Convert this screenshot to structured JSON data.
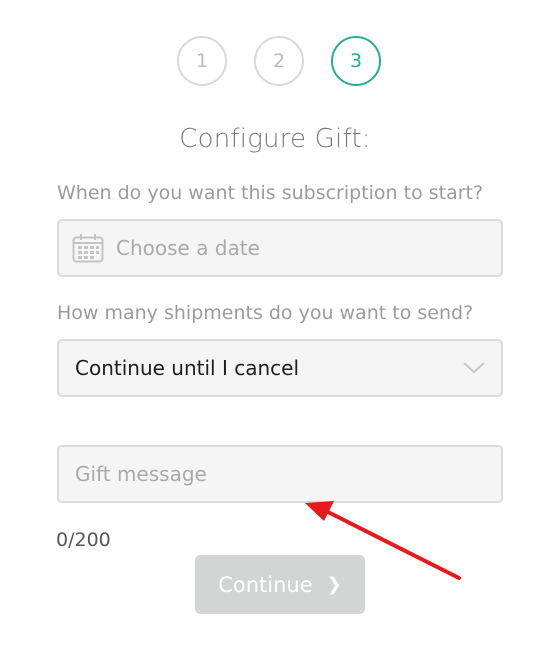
{
  "steps": [
    {
      "label": "1",
      "state": "inactive"
    },
    {
      "label": "2",
      "state": "inactive"
    },
    {
      "label": "3",
      "state": "active"
    }
  ],
  "title": "Configure Gift:",
  "start_question": "When do you want this subscription to start?",
  "date_field": {
    "placeholder": "Choose a date",
    "icon": "calendar-icon"
  },
  "shipments_question": "How many shipments do you want to send?",
  "shipments_select": {
    "value": "Continue until I cancel",
    "icon": "chevron-down-icon"
  },
  "gift_message": {
    "placeholder": "Gift message",
    "value": ""
  },
  "char_counter": "0/200",
  "continue_button": {
    "label": "Continue",
    "icon": "chevron-right-icon"
  },
  "colors": {
    "accent": "#27ae8f",
    "annotation_arrow": "#e8191b",
    "button_disabled": "#d2d5d4"
  }
}
